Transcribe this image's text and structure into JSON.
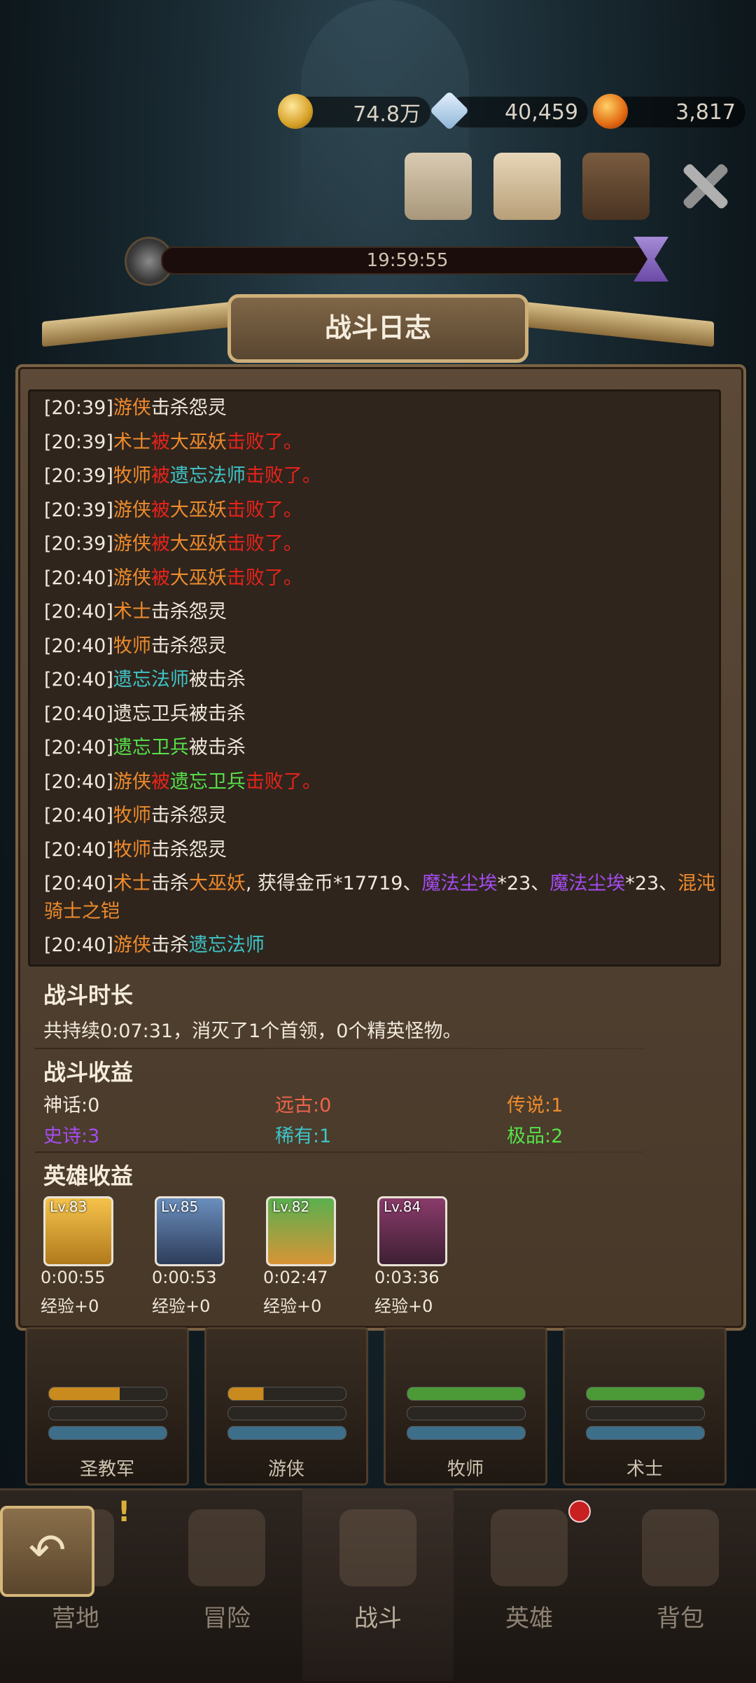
{
  "resources": {
    "gold": "74.8万",
    "gems": "40,459",
    "ore": "3,817"
  },
  "timer": "19:59:55",
  "panel": {
    "title": "战斗日志"
  },
  "log": [
    [
      {
        "t": "[20:39]",
        "c": "wh"
      },
      {
        "t": "游侠",
        "c": "or"
      },
      {
        "t": "击杀怨灵",
        "c": "wh"
      }
    ],
    [
      {
        "t": "[20:39]",
        "c": "wh"
      },
      {
        "t": "术士",
        "c": "or"
      },
      {
        "t": "被",
        "c": "red"
      },
      {
        "t": "大巫妖",
        "c": "or"
      },
      {
        "t": "击败了。",
        "c": "red"
      }
    ],
    [
      {
        "t": "[20:39]",
        "c": "wh"
      },
      {
        "t": "牧师",
        "c": "or"
      },
      {
        "t": "被",
        "c": "red"
      },
      {
        "t": "遗忘法师",
        "c": "cy"
      },
      {
        "t": "击败了。",
        "c": "red"
      }
    ],
    [
      {
        "t": "[20:39]",
        "c": "wh"
      },
      {
        "t": "游侠",
        "c": "or"
      },
      {
        "t": "被",
        "c": "red"
      },
      {
        "t": "大巫妖",
        "c": "or"
      },
      {
        "t": "击败了。",
        "c": "red"
      }
    ],
    [
      {
        "t": "[20:39]",
        "c": "wh"
      },
      {
        "t": "游侠",
        "c": "or"
      },
      {
        "t": "被",
        "c": "red"
      },
      {
        "t": "大巫妖",
        "c": "or"
      },
      {
        "t": "击败了。",
        "c": "red"
      }
    ],
    [
      {
        "t": "[20:40]",
        "c": "wh"
      },
      {
        "t": "游侠",
        "c": "or"
      },
      {
        "t": "被",
        "c": "red"
      },
      {
        "t": "大巫妖",
        "c": "or"
      },
      {
        "t": "击败了。",
        "c": "red"
      }
    ],
    [
      {
        "t": "[20:40]",
        "c": "wh"
      },
      {
        "t": "术士",
        "c": "or"
      },
      {
        "t": "击杀怨灵",
        "c": "wh"
      }
    ],
    [
      {
        "t": "[20:40]",
        "c": "wh"
      },
      {
        "t": "牧师",
        "c": "or"
      },
      {
        "t": "击杀怨灵",
        "c": "wh"
      }
    ],
    [
      {
        "t": "[20:40]",
        "c": "wh"
      },
      {
        "t": "遗忘法师",
        "c": "cy"
      },
      {
        "t": "被击杀",
        "c": "wh"
      }
    ],
    [
      {
        "t": "[20:40]遗忘卫兵被击杀",
        "c": "wh"
      }
    ],
    [
      {
        "t": "[20:40]",
        "c": "wh"
      },
      {
        "t": "遗忘卫兵",
        "c": "gr"
      },
      {
        "t": "被击杀",
        "c": "wh"
      }
    ],
    [
      {
        "t": "[20:40]",
        "c": "wh"
      },
      {
        "t": "游侠",
        "c": "or"
      },
      {
        "t": "被",
        "c": "red"
      },
      {
        "t": "遗忘卫兵",
        "c": "gr"
      },
      {
        "t": "击败了。",
        "c": "red"
      }
    ],
    [
      {
        "t": "[20:40]",
        "c": "wh"
      },
      {
        "t": "牧师",
        "c": "or"
      },
      {
        "t": "击杀怨灵",
        "c": "wh"
      }
    ],
    [
      {
        "t": "[20:40]",
        "c": "wh"
      },
      {
        "t": "牧师",
        "c": "or"
      },
      {
        "t": "击杀怨灵",
        "c": "wh"
      }
    ],
    [
      {
        "t": "[20:40]",
        "c": "wh"
      },
      {
        "t": "术士",
        "c": "or"
      },
      {
        "t": "击杀",
        "c": "wh"
      },
      {
        "t": "大巫妖",
        "c": "or"
      },
      {
        "t": ", 获得金币*17719、",
        "c": "wh"
      },
      {
        "t": "魔法尘埃",
        "c": "pu"
      },
      {
        "t": "*23、",
        "c": "wh"
      },
      {
        "t": "魔法尘埃",
        "c": "pu"
      },
      {
        "t": "*23、",
        "c": "wh"
      },
      {
        "t": "混沌骑士之铠",
        "c": "or"
      }
    ],
    [
      {
        "t": "[20:40]",
        "c": "wh"
      },
      {
        "t": "游侠",
        "c": "or"
      },
      {
        "t": "击杀",
        "c": "wh"
      },
      {
        "t": "遗忘法师",
        "c": "cy"
      }
    ]
  ],
  "duration": {
    "title": "战斗时长",
    "text": "共持续0:07:31，消灭了1个首领，0个精英怪物。"
  },
  "loot": {
    "title": "战斗收益",
    "items": [
      {
        "label": "神话:0",
        "color": "#f1e9dc"
      },
      {
        "label": "远古:0",
        "color": "#f0654a"
      },
      {
        "label": "传说:1",
        "color": "#ef8b2c"
      },
      {
        "label": "史诗:3",
        "color": "#a54cf0"
      },
      {
        "label": "稀有:1",
        "color": "#3fc4c7"
      },
      {
        "label": "极品:2",
        "color": "#57e14a"
      }
    ]
  },
  "hero_rewards": {
    "title": "英雄收益",
    "heroes": [
      {
        "level": "Lv.83",
        "time": "0:00:55",
        "exp": "经验+0"
      },
      {
        "level": "Lv.85",
        "time": "0:00:53",
        "exp": "经验+0"
      },
      {
        "level": "Lv.82",
        "time": "0:02:47",
        "exp": "经验+0"
      },
      {
        "level": "Lv.84",
        "time": "0:03:36",
        "exp": "经验+0"
      }
    ]
  },
  "party": [
    "圣教军",
    "游侠",
    "牧师",
    "术士"
  ],
  "nav": [
    "营地",
    "冒险",
    "战斗",
    "英雄",
    "背包"
  ]
}
